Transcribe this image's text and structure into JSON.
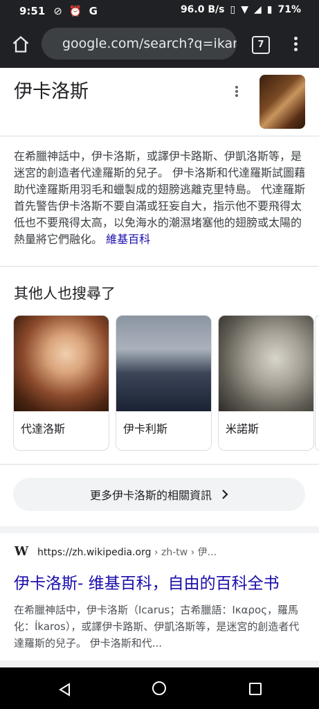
{
  "status": {
    "time": "9:51",
    "net_speed": "96.0 B/s",
    "battery": "71%"
  },
  "browser": {
    "url": "google.com/search?q=ikar",
    "tab_count": "7"
  },
  "kp": {
    "title": "伊卡洛斯",
    "description": "在希臘神話中，伊卡洛斯，或譯伊卡路斯、伊凱洛斯等，是迷宮的創造者代達羅斯的兒子。 伊卡洛斯和代達羅斯試圖藉助代達羅斯用羽毛和蠟製成的翅膀逃離克里特島。 代達羅斯首先警告伊卡洛斯不要自滿或狂妄自大，指示他不要飛得太低也不要飛得太高，以免海水的潮濕堵塞他的翅膀或太陽的熱量將它們融化。",
    "source_link": "維基百科"
  },
  "people_also": {
    "title": "其他人也搜尋了",
    "items": [
      {
        "label": "代達洛斯"
      },
      {
        "label": "伊卡利斯"
      },
      {
        "label": "米諾斯"
      }
    ]
  },
  "more_button": "更多伊卡洛斯的相關資訊",
  "result": {
    "url": "https://zh.wikipedia.org",
    "crumb": " › zh-tw › 伊...",
    "title": "伊卡洛斯- 维基百科，自由的百科全书",
    "snippet": "在希臘神話中，伊卡洛斯（Icarus；古希臘語：Ικαρος，羅馬化：Íkaros），或譯伊卡路斯、伊凱洛斯等，是迷宮的創造者代達羅斯的兒子。 伊卡洛斯和代..."
  }
}
